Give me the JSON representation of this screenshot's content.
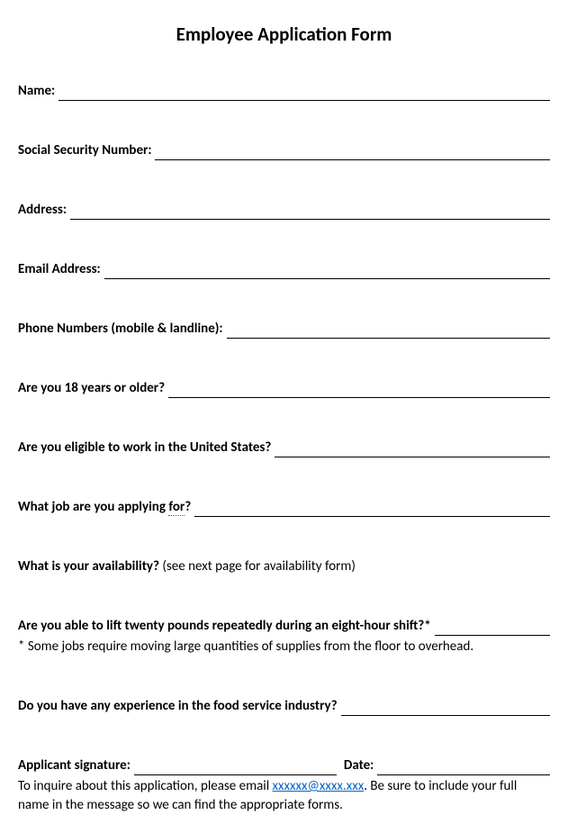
{
  "title": "Employee Application Form",
  "fields": {
    "name": "Name:",
    "ssn": "Social Security Number:",
    "address": "Address:",
    "email": "Email Address:",
    "phone": "Phone Numbers (mobile & landline):",
    "age": "Are you 18 years or older?",
    "eligible": "Are you eligible to work in the United States?",
    "job_prefix": "What job are you applying ",
    "job_for": "for",
    "job_suffix": "?",
    "availability_label": "What is your availability?",
    "availability_note": " (see next page for availability form)",
    "lift": "Are you able to lift twenty pounds repeatedly during an eight-hour shift?*",
    "lift_note": "* Some jobs require moving large quantities of supplies from the floor to overhead.",
    "experience": "Do you have any experience in the food service industry?",
    "signature": "Applicant signature:",
    "date": "Date:"
  },
  "footer": {
    "prefix": "To inquire about this application, please email ",
    "email_mask": "xxxxxx@xxxx.xxx",
    "suffix": ". Be sure to include your full name in the message so we can find the appropriate forms."
  }
}
